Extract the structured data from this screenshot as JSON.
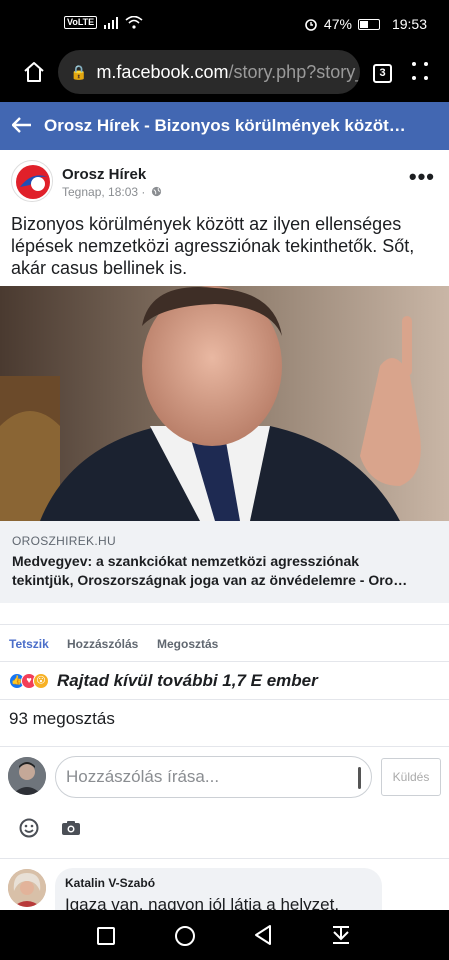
{
  "status_bar": {
    "volte": "VoLTE",
    "battery_percent": "47%",
    "time": "19:53"
  },
  "browser": {
    "url_host": "m.facebook.com",
    "url_path": "/story.php?story_f",
    "tab_count": "3"
  },
  "header": {
    "title": "Orosz Hírek - Bizonyos körülmények közöt…"
  },
  "post": {
    "page_name": "Orosz Hírek",
    "timestamp": "Tegnap, 18:03 ·",
    "text": "Bizonyos körülmények között az ilyen ellenséges lépések nemzetközi agressziónak tekinthetők. Sőt, akár casus bellinek is."
  },
  "link_preview": {
    "domain": "OROSZHIREK.HU",
    "title_line1": "Medvegyev: a szankciókat nemzetközi agressziónak",
    "title_line2": "tekintjük, Oroszországnak joga van az önvédelemre - Oro…"
  },
  "actions": {
    "like": "Tetszik",
    "comment": "Hozzászólás",
    "share": "Megosztás"
  },
  "reactions": {
    "summary": "Rajtad kívül további 1,7 E ember"
  },
  "shares": {
    "text": "93 megosztás"
  },
  "comment_box": {
    "placeholder": "Hozzászólás írása...",
    "send_label": "Küldés"
  },
  "comments": [
    {
      "author": "Katalin V-Szabó",
      "text": "Igaza van, nagyon jól látja a helyzet."
    }
  ],
  "colors": {
    "facebook_blue": "#4267b2",
    "link_blue": "#4b6ec9",
    "like_blue": "#1877f2",
    "love_red": "#f33e58",
    "wow_yellow": "#f7b125"
  }
}
